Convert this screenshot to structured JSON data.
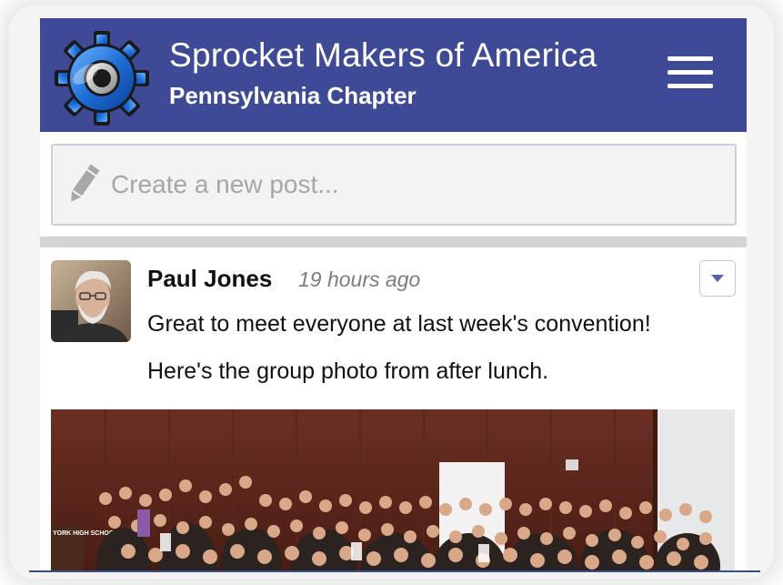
{
  "header": {
    "title": "Sprocket Makers of America",
    "subtitle": "Pennsylvania Chapter",
    "logo_icon": "gear-logo-icon",
    "menu_icon": "hamburger-menu-icon"
  },
  "composer": {
    "placeholder": "Create a new post...",
    "icon": "pencil-icon"
  },
  "post": {
    "author": "Paul Jones",
    "timestamp": "19 hours ago",
    "lines": [
      "Great to meet everyone at last week's convention!",
      "Here's the group photo from after lunch."
    ],
    "menu_icon": "chevron-down-icon",
    "photo_sign_text": "YORK HIGH SCHOOL"
  },
  "colors": {
    "header_bg": "#3f4a96",
    "accent": "#5562a8",
    "divider": "#d4d4d4"
  }
}
